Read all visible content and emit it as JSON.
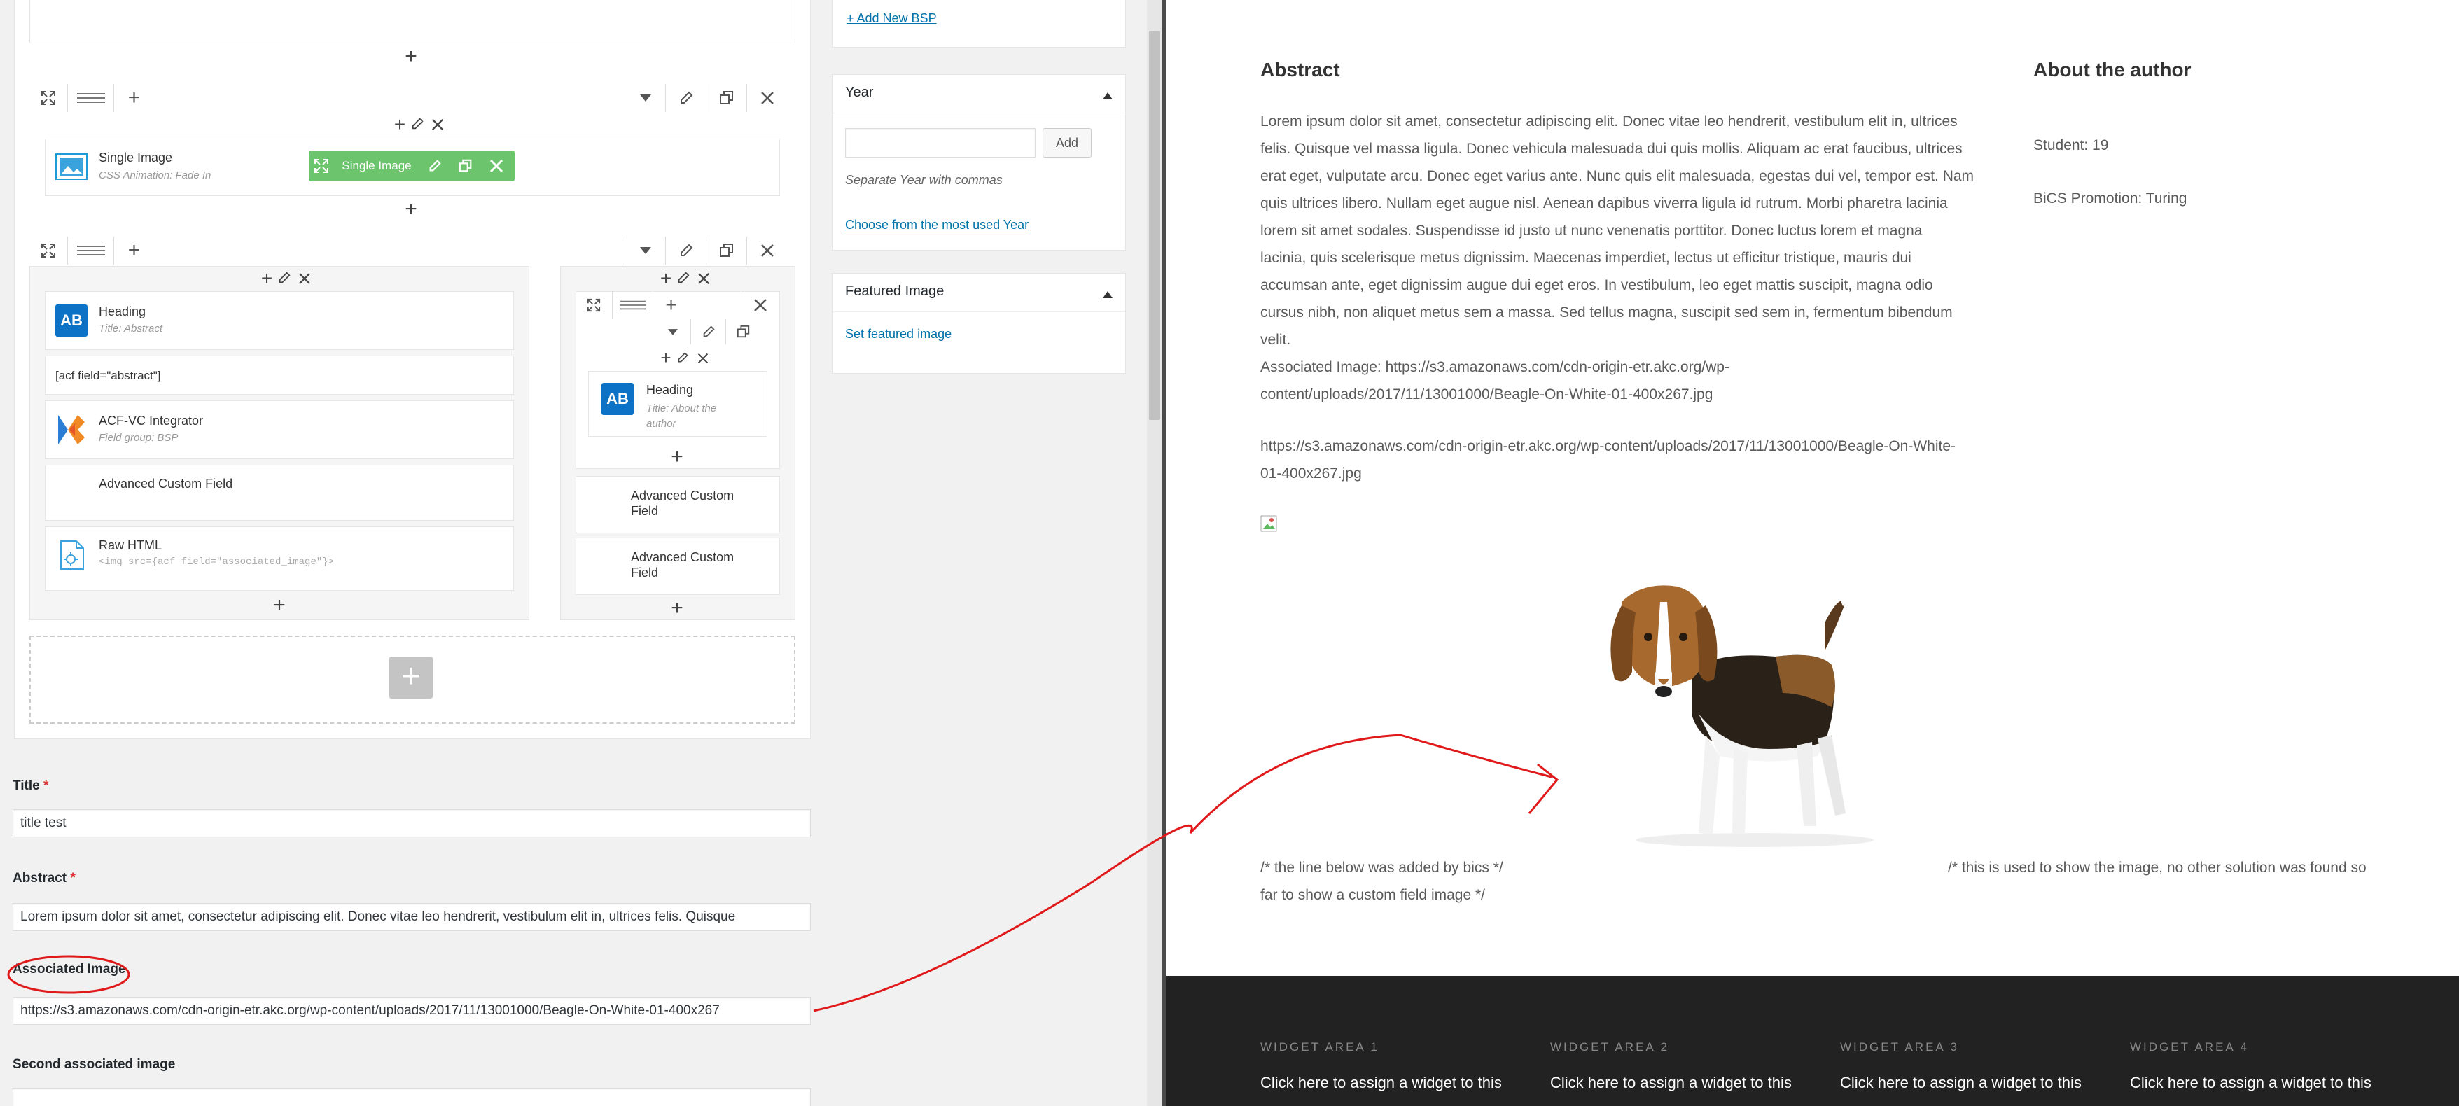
{
  "colors": {
    "accent_link": "#0073aa",
    "required": "#dc3232",
    "green_element": "#6cc56c",
    "footer_bg": "#222222",
    "annotation_red": "#e0191b"
  },
  "editor": {
    "row1": {
      "single_image": {
        "title": "Single Image",
        "subtitle": "CSS Animation: Fade In",
        "badge": "Single Image"
      }
    },
    "row2": {
      "col1": {
        "heading": {
          "title": "Heading",
          "subtitle": "Title: Abstract"
        },
        "shortcode": "[acf field=\"abstract\"]",
        "integrator": {
          "title": "ACF-VC Integrator",
          "subtitle": "Field group: BSP"
        },
        "acf": {
          "title": "Advanced Custom Field"
        },
        "raw_html": {
          "title": "Raw HTML",
          "subtitle": "<img src={acf field=\"associated_image\"}>"
        }
      },
      "col2": {
        "heading": {
          "title": "Heading",
          "subtitle": "Title: About the author"
        },
        "acf1": "Advanced Custom Field",
        "acf2": "Advanced Custom Field"
      }
    }
  },
  "sidebar": {
    "add_new": "+ Add New BSP",
    "year": {
      "title": "Year",
      "add_label": "Add",
      "input_value": "",
      "hint": "Separate Year with commas",
      "choose": "Choose from the most used Year"
    },
    "featured": {
      "title": "Featured Image",
      "link": "Set featured image"
    }
  },
  "form": {
    "title": {
      "label": "Title",
      "req": "*",
      "value": "title test"
    },
    "abstract": {
      "label": "Abstract",
      "req": "*",
      "value": "Lorem ipsum dolor sit amet, consectetur adipiscing elit. Donec vitae leo hendrerit, vestibulum elit in, ultrices felis. Quisque"
    },
    "assoc": {
      "label": "Associated Image",
      "value": "https://s3.amazonaws.com/cdn-origin-etr.akc.org/wp-content/uploads/2017/11/13001000/Beagle-On-White-01-400x267"
    },
    "second": {
      "label": "Second associated image",
      "value": ""
    }
  },
  "preview": {
    "abstract_heading": "Abstract",
    "author_heading": "About the author",
    "student": "Student: 19",
    "promotion": "BiCS Promotion: Turing",
    "para_lines": [
      "Lorem ipsum dolor sit amet, consectetur adipiscing elit. Donec vitae leo hendrerit, vestibulum elit in, ultrices",
      "felis. Quisque vel massa ligula. Donec vehicula malesuada dui quis mollis. Aliquam ac erat faucibus, ultrices",
      "erat eget, vulputate arcu. Donec eget varius ante. Nunc quis elit malesuada, egestas dui vel, tempor est. Nam",
      "quis ultrices libero. Nullam eget augue nisl. Aenean dapibus viverra ligula id rutrum. Morbi pharetra lacinia",
      "lorem sit amet sodales. Suspendisse id justo ut nunc venenatis porttitor. Donec luctus lorem et magna",
      "lacinia, quis scelerisque metus dignissim. Maecenas imperdiet, lectus ut efficitur tristique, mauris dui",
      "accumsan ante, eget dignissim augue dui eget eros. In vestibulum, leo eget mattis suscipit, magna odio",
      "cursus nibh, non aliquet metus sem a massa. Sed tellus magna, suscipit sed sem in, fermentum bibendum",
      "velit."
    ],
    "assoc_lines": [
      "Associated Image: https://s3.amazonaws.com/cdn-origin-etr.akc.org/wp-",
      "content/uploads/2017/11/13001000/Beagle-On-White-01-400x267.jpg"
    ],
    "url_lines": [
      "https://s3.amazonaws.com/cdn-origin-etr.akc.org/wp-content/uploads/2017/11/13001000/Beagle-On-White-",
      "01-400x267.jpg"
    ],
    "comment_left_lines": [
      "/* the line below was added by bics */",
      "far to show a custom field image */"
    ],
    "comment_right": "/* this is used to show the image, no other solution was found so"
  },
  "footer": {
    "areas": [
      {
        "title": "WIDGET AREA 1",
        "text": "Click here to assign a widget to this"
      },
      {
        "title": "WIDGET AREA 2",
        "text": "Click here to assign a widget to this"
      },
      {
        "title": "WIDGET AREA 3",
        "text": "Click here to assign a widget to this"
      },
      {
        "title": "WIDGET AREA 4",
        "text": "Click here to assign a widget to this"
      }
    ]
  }
}
